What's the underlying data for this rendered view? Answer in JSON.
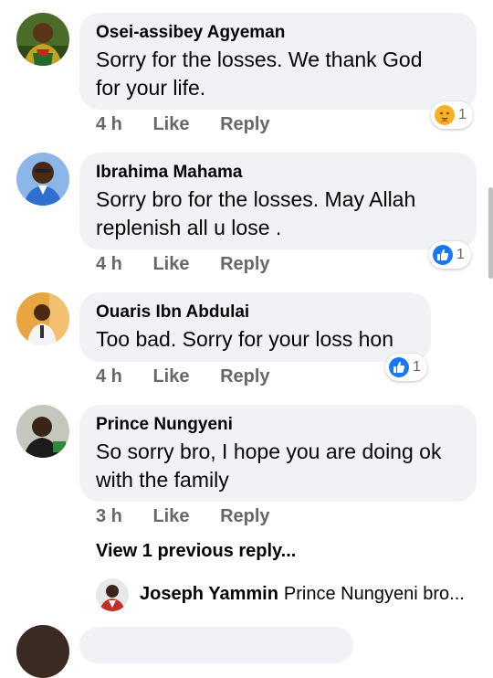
{
  "comments": [
    {
      "author": "Osei-assibey Agyeman",
      "text_line1": "Sorry for the losses.  We thank God",
      "text_line2": "for your life.",
      "time": "4 h",
      "like": "Like",
      "reply": "Reply",
      "reaction": {
        "icon": "care-emoji-icon",
        "count": "1"
      }
    },
    {
      "author": "Ibrahima Mahama",
      "text_line1": "Sorry bro for the losses. May Allah",
      "text_line2": "replenish all u lose .",
      "time": "4 h",
      "like": "Like",
      "reply": "Reply",
      "reaction": {
        "icon": "like-thumb-icon",
        "count": "1"
      }
    },
    {
      "author": "Ouaris Ibn Abdulai",
      "text_line1": "Too bad. Sorry for your loss hon",
      "time": "4 h",
      "like": "Like",
      "reply": "Reply",
      "reaction": {
        "icon": "like-thumb-icon",
        "count": "1"
      }
    },
    {
      "author": "Prince Nungyeni",
      "text_line1": "So sorry bro, I hope you are doing ok",
      "text_line2": "with the family",
      "time": "3 h",
      "like": "Like",
      "reply": "Reply"
    }
  ],
  "view_replies": "View 1 previous reply...",
  "reply_preview": {
    "author": "Joseph Yammin",
    "text": "Prince Nungyeni bro..."
  },
  "colors": {
    "bubble": "#f0f2f5",
    "meta_text": "#65676b",
    "like_blue": "#1877f2"
  }
}
